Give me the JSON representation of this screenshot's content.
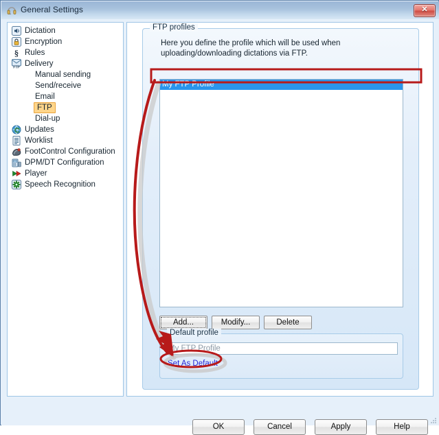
{
  "window": {
    "title": "General Settings",
    "title_icon": "headset-icon",
    "close_label": "✕"
  },
  "sidebar": {
    "items": [
      {
        "label": "Dictation",
        "icon": "speaker-icon",
        "level": 0,
        "selected": false
      },
      {
        "label": "Encryption",
        "icon": "padlock-icon",
        "level": 0,
        "selected": false
      },
      {
        "label": "Rules",
        "icon": "section-sign-icon",
        "level": 0,
        "selected": false
      },
      {
        "label": "Delivery",
        "icon": "ftp-envelope-icon",
        "level": 0,
        "selected": false
      },
      {
        "label": "Manual sending",
        "icon": "",
        "level": 1,
        "selected": false
      },
      {
        "label": "Send/receive",
        "icon": "",
        "level": 1,
        "selected": false
      },
      {
        "label": "Email",
        "icon": "",
        "level": 1,
        "selected": false
      },
      {
        "label": "FTP",
        "icon": "",
        "level": 1,
        "selected": true
      },
      {
        "label": "Dial-up",
        "icon": "",
        "level": 1,
        "selected": false
      },
      {
        "label": "Updates",
        "icon": "globe-refresh-icon",
        "level": 0,
        "selected": false
      },
      {
        "label": "Worklist",
        "icon": "list-document-icon",
        "level": 0,
        "selected": false
      },
      {
        "label": "FootControl Configuration",
        "icon": "foot-pedal-icon",
        "level": 0,
        "selected": false
      },
      {
        "label": "DPM/DT Configuration",
        "icon": "device-icon",
        "level": 0,
        "selected": false
      },
      {
        "label": "Player",
        "icon": "play-arrow-icon",
        "level": 0,
        "selected": false
      },
      {
        "label": "Speech Recognition",
        "icon": "green-gear-icon",
        "level": 0,
        "selected": false
      }
    ]
  },
  "main": {
    "ftp_group_title": "FTP profiles",
    "description": "Here you define the profile which will be used when uploading/downloading dictations via FTP.",
    "profile_list": [
      {
        "label": "My FTP Profile",
        "selected": true
      }
    ],
    "buttons": {
      "add": "Add...",
      "modify": "Modify...",
      "delete": "Delete"
    },
    "default_group_title": "Default profile",
    "default_profile_value": "My FTP Profile",
    "set_as_default_link": "Set As Default"
  },
  "dialog_buttons": {
    "ok": "OK",
    "cancel": "Cancel",
    "apply": "Apply",
    "help": "Help"
  },
  "annotation": {
    "color": "#b71a1a",
    "highlight_list_item": "My FTP Profile",
    "highlight_link": "Set As Default",
    "arrow_from": "profile list selection",
    "arrow_to": "Set As Default link"
  },
  "colors": {
    "titlebar_top": "#9ab6d6",
    "titlebar_bottom": "#d8e7f5",
    "client_bg": "#e6f0fa",
    "selection_blue": "#2a95ec",
    "ftp_highlight": "#ffd58a",
    "link_blue": "#2323d8",
    "annotation_red": "#b71a1a"
  }
}
